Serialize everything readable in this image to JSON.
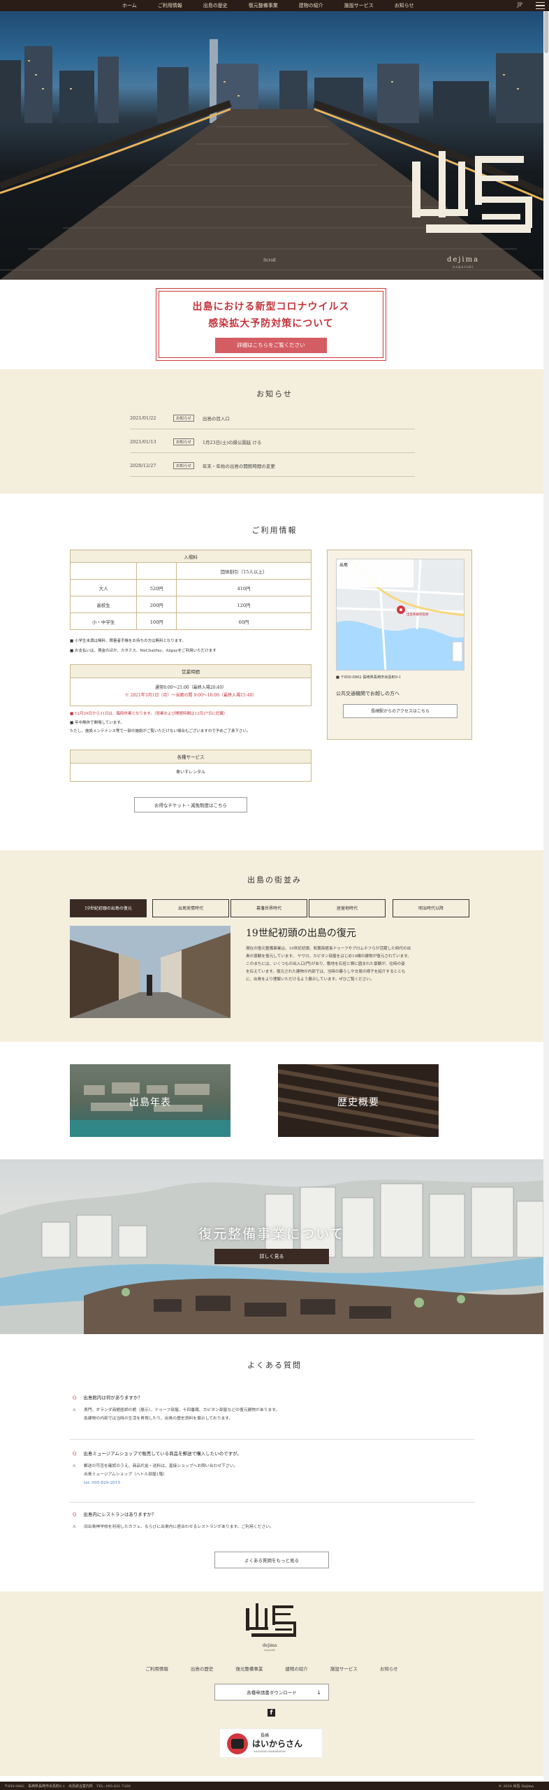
{
  "nav": {
    "items": [
      "ホーム",
      "ご利用情報",
      "出島の歴史",
      "復元整備事業",
      "建物の紹介",
      "施設サービス",
      "お知らせ"
    ],
    "lang": "JP"
  },
  "hero": {
    "logo_text": "出島",
    "sub": "dejima",
    "sub2": "nagasaki",
    "scroll": "Scroll"
  },
  "notice": {
    "line1": "出島における新型コロナウイルス",
    "line2": "感染拡大予防対策について",
    "button": "詳細はこちらをご覧ください"
  },
  "news": {
    "title": "お知らせ",
    "items": [
      {
        "date": "2021/01/22",
        "badge": "お知らせ",
        "text": "出島の目入口"
      },
      {
        "date": "2021/01/13",
        "badge": "お知らせ",
        "text": "1月23日(土)の縁公園延 ける"
      },
      {
        "date": "2020/12/27",
        "badge": "お知らせ",
        "text": "年末・年始の出島の開館時間の変更"
      }
    ]
  },
  "info": {
    "title": "ご利用情報",
    "fee_header": "入場料",
    "fee_group": "団体割引（15人以上）",
    "rows": [
      {
        "label": "大人",
        "price": "520円",
        "group": "410円"
      },
      {
        "label": "高校生",
        "price": "200円",
        "group": "120円"
      },
      {
        "label": "小・中学生",
        "price": "100円",
        "group": "60円"
      }
    ],
    "note1": "■ 小学生未満は無料、障害者手帳をお持ちの方は無料となります。",
    "note2": "■ お支払いは、現金のほか、カタテス、WeChatPay、Alipayをご利用いただけます",
    "hours_head": "営業時間",
    "hours1": "通常8:00～21:00（最終入場20:40）",
    "hours2": "※ 2021年3月1日（月）～当面の間 9:00～16:00（最終入場15:40）",
    "red_note": "■ 12月29日から31日は、臨時休業となります。（営業および開館時間は12月27日に記載）",
    "note3": "■ 年中無休で開場しています。",
    "note4": "ただし、施設メンテナンス等で一部の施設がご覧いただけない場合もございますので予めご了承下さい。",
    "service_head": "各種サービス",
    "service_body": "車いすレンタル",
    "ticket_btn": "お得なチケット・減免制度はこちら",
    "map_name": "出島",
    "map_label": "出島和蘭商館跡",
    "address": "■ 〒850-0862 長崎県長崎市出島町6-1",
    "transport": "公共交通機関でお越しの方へ",
    "transport_btn": "長崎駅からのアクセスはこちら"
  },
  "streets": {
    "title": "出島の街並み",
    "tabs": [
      "19世紀初頭の出島の復元",
      "出島実情時代",
      "幕藩世界時代",
      "居留地時代",
      "明治時代以降"
    ],
    "era_title": "19世紀初頭の出島の復元",
    "era_text": [
      "現在の復元整備事業は、19世紀初頭、和蘭商館長ドゥーフやブロムホフらが活躍した時代の出",
      "島の景観を復元しています。 ヤワロ、カピタン部屋をはじめ19棟の建物が復元されています。",
      "このまちには、いくつもの出入口(門)があり、敷地を石垣と塀に囲まれた景観が、往時の姿",
      "を伝えています。復元された建物の内部では、当時の暮らしや交易の様子を紹介するととも",
      "に、出島をより理解いただけるよう展示しています。ぜひご覧ください。"
    ],
    "card1": "出島年表",
    "card2": "歴史概要"
  },
  "restore": {
    "title": "復元整備事業について",
    "button": "詳しく見る"
  },
  "faq": {
    "title": "よくある質問",
    "items": [
      {
        "q": "出島館内は何がありますか？",
        "a": [
          "表門、オランダ商館医師の館（展示）、ドゥーフ部屋、十四番蔵、カピタン部屋などの復元建物があります。",
          "各建物の内部では当時の生活を再現したり、出島の歴史資料を展示しております。"
        ]
      },
      {
        "q": "出島ミュージアムショップで販売している商品を郵送で購入したいのですが。",
        "a": [
          "郵送の可否を確認のうえ、商品代金・送料は、直接ショップへお問い合わせ下さい。",
          "出島ミュージアムショップ（ヘトル部屋1階）",
          "tel: 095-829-2015"
        ]
      },
      {
        "q": "出島内にレストランはありますか？",
        "a": [
          "旧出島神学校を利用したカフェ、ならびに出島内に居合わせるレストランがあります。ご利用ください。"
        ]
      }
    ],
    "more_btn": "よくある質問をもっと見る"
  },
  "footer": {
    "logo_text": "出島",
    "logo_sub": "dejima",
    "logo_sub2": "nagasaki",
    "nav": [
      "ご利用情報",
      "出島の歴史",
      "復元整備事業",
      "建物の紹介",
      "施設サービス",
      "お知らせ"
    ],
    "download_btn": "各種申請書ダウンロード",
    "badge_top": "長崎",
    "badge_main": "はいからさん",
    "badge_sub": "NAGASAKI HAIKARASAN",
    "bar_left": "〒850-0862　長崎県長崎市出島町6-1　出島総合案内所　TEL: 095-821-7200",
    "bar_right": "© 2020 出島 Dejima"
  }
}
